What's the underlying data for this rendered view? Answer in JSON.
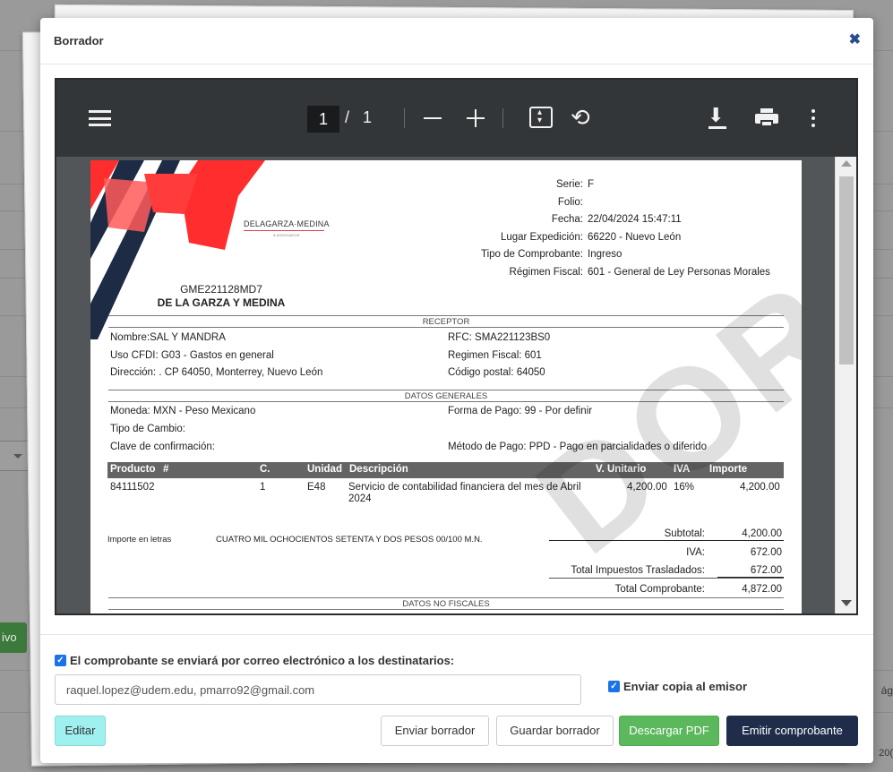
{
  "background": {
    "left_button_label": "ivo",
    "right_text_1": "ág",
    "right_text_2": "20("
  },
  "modal": {
    "title": "Borrador",
    "close_icon": "close-icon"
  },
  "viewer": {
    "page_current": "1",
    "page_separator": "/",
    "page_total": "1",
    "icons": [
      "menu-icon",
      "zoom-out-icon",
      "zoom-in-icon",
      "fit-page-icon",
      "rotate-icon",
      "download-icon",
      "print-icon",
      "more-options-icon"
    ]
  },
  "document": {
    "logo_name": "DELAGARZA·MEDINA",
    "logo_sub": "& ASOCIADOS",
    "meta_labels": [
      "Serie:",
      "Folio:",
      "Fecha:",
      "Lugar Expedición:",
      "Tipo de Comprobante:",
      "Régimen Fiscal:"
    ],
    "meta_values": [
      "F",
      "",
      "22/04/2024 15:47:11",
      "66220 - Nuevo León",
      "Ingreso",
      "601 - General de Ley Personas Morales"
    ],
    "emisor_rfc": "GME221128MD7",
    "emisor_name": "DE LA GARZA Y MEDINA",
    "receptor_title": "RECEPTOR",
    "receptor": {
      "nombre": "Nombre:SAL Y MANDRA",
      "uso_cfdi": "Uso CFDI: G03 - Gastos en general",
      "direccion": "Dirección: . CP 64050, Monterrey, Nuevo León",
      "rfc": "RFC: SMA221123BS0",
      "regimen": "Regimen Fiscal: 601",
      "cp": "Código postal: 64050"
    },
    "generales_title": "DATOS GENERALES",
    "generales": {
      "moneda": "Moneda: MXN - Peso Mexicano",
      "tipo_cambio": "Tipo de Cambio:",
      "clave_conf": "Clave de confirmación:",
      "forma_pago": "Forma de Pago: 99 - Por definir",
      "metodo_pago": "Método de Pago: PPD - Pago en parcialidades o diferido"
    },
    "table_headers": [
      "Producto",
      "#",
      "C.",
      "Unidad",
      "Descripción",
      "V. Unitario",
      "IVA",
      "Importe"
    ],
    "table_rows": [
      {
        "producto": "84111502",
        "cantidad": "1",
        "unidad": "E48",
        "descripcion": "Servicio de contabilidad financiera del mes de Abril 2024",
        "unitario": "4,200.00",
        "iva": "16%",
        "importe": "4,200.00"
      }
    ],
    "importe_letras_label": "Importe en letras",
    "importe_letras": "CUATRO MIL OCHOCIENTOS SETENTA Y DOS PESOS 00/100 M.N.",
    "totals_labels": [
      "Subtotal:",
      "IVA:",
      "Total Impuestos Trasladados:",
      "Total Comprobante:"
    ],
    "totals_values": [
      "4,200.00",
      "672.00",
      "672.00",
      "4,872.00"
    ],
    "no_fiscales_title": "DATOS NO FISCALES",
    "watermark": "DOR"
  },
  "footer": {
    "send_email_label": "El comprobante se enviará por correo electrónico a los destinatarios:",
    "emails": "raquel.lopez@udem.edu, pmarro92@gmail.com",
    "copy_label": "Enviar copia al emisor",
    "buttons": {
      "edit": "Editar",
      "send_draft": "Enviar borrador",
      "save_draft": "Guardar borrador",
      "download_pdf": "Descargar PDF",
      "emit": "Emitir comprobante"
    },
    "colors": {
      "edit_bg": "#9ff1ef",
      "pdf_bg": "#5cb85c",
      "emit_bg": "#1f2d4a",
      "checkbox": "#1a73e8"
    }
  }
}
